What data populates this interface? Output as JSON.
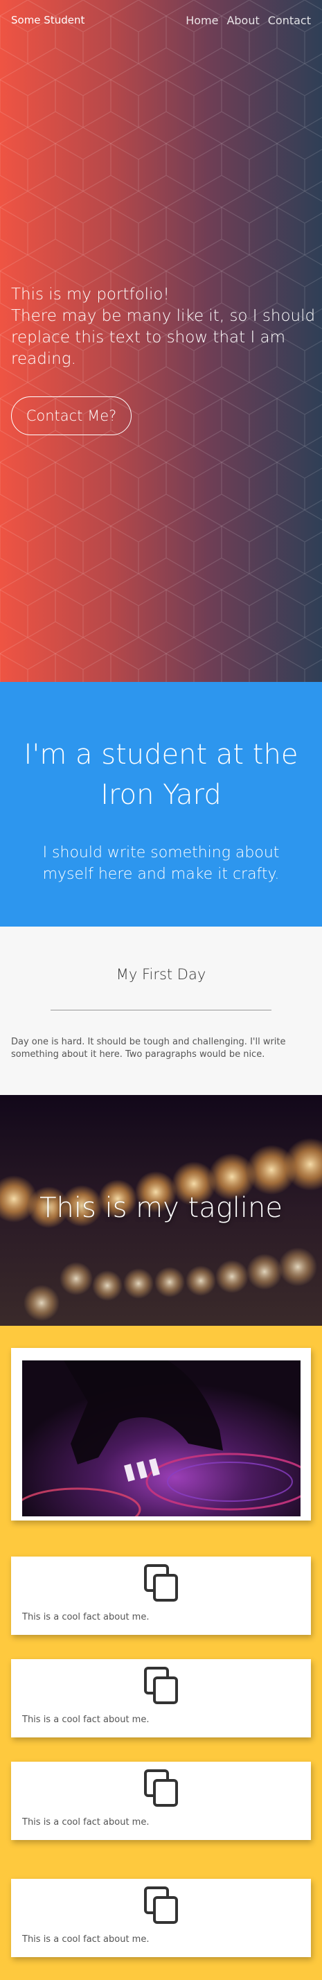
{
  "header": {
    "brand": "Some Student",
    "nav": [
      {
        "label": "Home"
      },
      {
        "label": "About"
      },
      {
        "label": "Contact"
      }
    ]
  },
  "hero": {
    "lines": [
      "This is my portfolio!",
      "There may be many like it, so I should replace this text to show that I am reading."
    ],
    "button_label": "Contact Me?",
    "colors": {
      "gradient_start": "#ef5443",
      "gradient_end": "#2f3f56"
    }
  },
  "intro": {
    "heading": "I'm a student at the Iron Yard",
    "subheading": "I should write something about myself here and make it crafty.",
    "background": "#2d96ee"
  },
  "first_day": {
    "title": "My First Day",
    "body": "Day one is hard. It should be tough and challenging. I'll write something about it here. Two paragraphs would be nice."
  },
  "tagline": {
    "text": "This is my tagline"
  },
  "cards": {
    "background": "#fec93e",
    "photo_icon": "dj-turntable-photo",
    "facts": [
      {
        "icon": "copy-icon",
        "text": "This is a cool fact about me."
      },
      {
        "icon": "copy-icon",
        "text": "This is a cool fact about me."
      },
      {
        "icon": "copy-icon",
        "text": "This is a cool fact about me."
      },
      {
        "icon": "copy-icon",
        "text": "This is a cool fact about me."
      }
    ]
  }
}
